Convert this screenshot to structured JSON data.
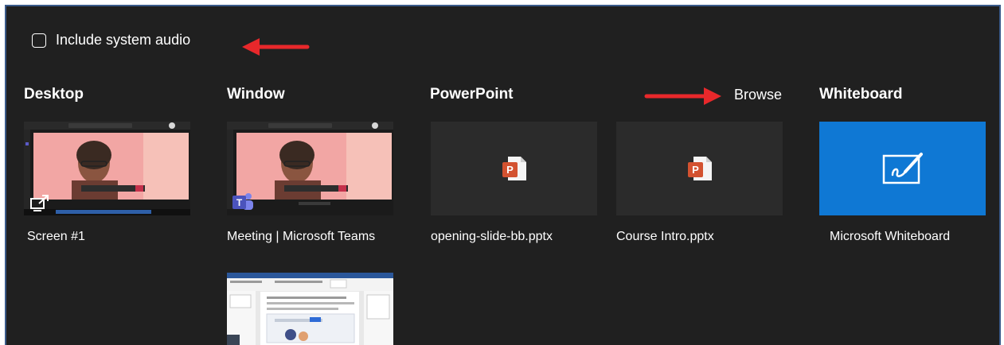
{
  "audio": {
    "label": "Include system audio",
    "checked": false
  },
  "sections": {
    "desktop": "Desktop",
    "window": "Window",
    "powerpoint": "PowerPoint",
    "browse": "Browse",
    "whiteboard": "Whiteboard"
  },
  "items": {
    "screen": "Screen #1",
    "teams_window": "Meeting | Microsoft Teams",
    "pptx_1": "opening-slide-bb.pptx",
    "pptx_2": "Course Intro.pptx",
    "whiteboard": "Microsoft Whiteboard"
  },
  "colors": {
    "background": "#202020",
    "tile": "#2b2b2b",
    "whiteboard": "#0f78d4",
    "arrow": "#e8282b",
    "powerpoint": "#d35230"
  },
  "icons": [
    "checkbox-icon",
    "share-screen-icon",
    "teams-icon",
    "powerpoint-file-icon",
    "whiteboard-pen-icon",
    "red-arrow-annotation"
  ]
}
